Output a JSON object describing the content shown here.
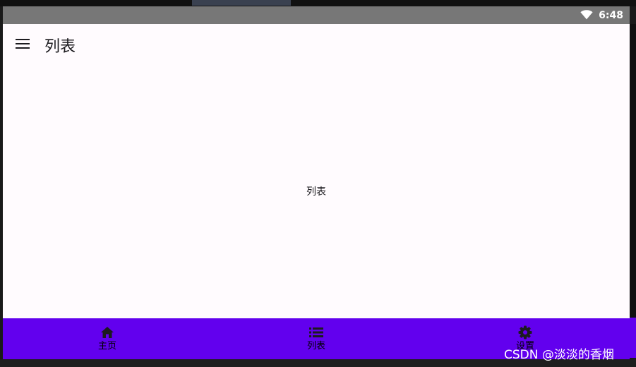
{
  "status_bar": {
    "time": "6:48",
    "icons": [
      "wifi-icon"
    ]
  },
  "app_bar": {
    "menu_icon": "menu-icon",
    "title": "列表"
  },
  "content": {
    "center_text": "列表"
  },
  "bottom_nav": {
    "items": [
      {
        "label": "主页",
        "icon": "home-icon"
      },
      {
        "label": "列表",
        "icon": "list-icon"
      },
      {
        "label": "设置",
        "icon": "settings-icon"
      }
    ]
  },
  "watermark": "CSDN @淡淡的香烟",
  "colors": {
    "primary": "#6200ee",
    "background": "#fffbfe",
    "status_bar": "#777777"
  }
}
